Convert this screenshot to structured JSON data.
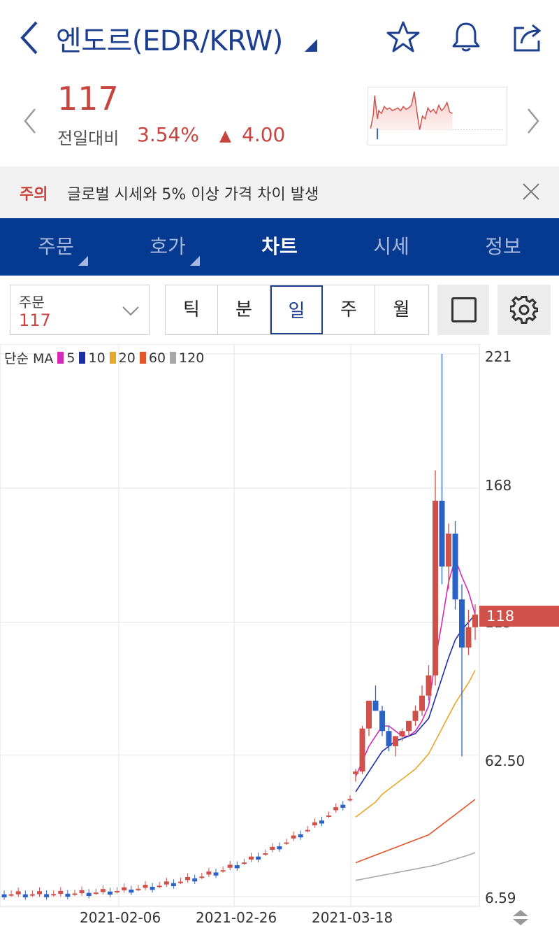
{
  "header": {
    "title": "엔도르(EDR/KRW)"
  },
  "price": {
    "current": "117",
    "prev_label": "전일대비",
    "change_pct": "3.54%",
    "change_symbol": "▲",
    "change_abs": "4.00"
  },
  "notice": {
    "tag": "주의",
    "text": "글로벌 시세와 5% 이상 가격 차이 발생"
  },
  "tabs": [
    {
      "label": "주문"
    },
    {
      "label": "호가"
    },
    {
      "label": "차트"
    },
    {
      "label": "시세"
    },
    {
      "label": "정보"
    }
  ],
  "controls": {
    "order_label": "주문",
    "order_value": "117",
    "periods": [
      "틱",
      "분",
      "일",
      "주",
      "월"
    ],
    "active_period": "일"
  },
  "colors": {
    "accent": "#063a91",
    "up": "#d0504a",
    "down": "#2b62c6",
    "ma5": "#d629b8",
    "ma10": "#1b2fa8",
    "ma20": "#e8a72a",
    "ma60": "#e2542a",
    "ma120": "#a8a8a8"
  },
  "chart": {
    "legend_prefix": "단순 MA",
    "ma_periods": [
      "5",
      "10",
      "20",
      "60",
      "120"
    ],
    "y_ticks": [
      "221",
      "168",
      "115",
      "62.50",
      "6.59"
    ],
    "current_price_label": "118",
    "x_ticks": [
      "2021-02-06",
      "2021-02-26",
      "2021-03-18"
    ]
  },
  "chart_data": {
    "type": "candlestick",
    "ylim": [
      6.59,
      221
    ],
    "yticks": [
      221,
      168,
      115,
      62.5,
      6.59
    ],
    "xticks": [
      "2021-02-06",
      "2021-02-26",
      "2021-03-18"
    ],
    "candles": [
      {
        "date": "2021-03-18",
        "open": 55,
        "high": 57,
        "low": 52,
        "close": 56
      },
      {
        "date": "2021-03-19",
        "open": 56,
        "high": 74,
        "low": 55,
        "close": 73
      },
      {
        "date": "2021-03-20",
        "open": 73,
        "high": 84,
        "low": 70,
        "close": 84
      },
      {
        "date": "2021-03-21",
        "open": 84,
        "high": 90,
        "low": 80,
        "close": 80
      },
      {
        "date": "2021-03-22",
        "open": 80,
        "high": 82,
        "low": 70,
        "close": 72
      },
      {
        "date": "2021-03-23",
        "open": 72,
        "high": 74,
        "low": 64,
        "close": 66
      },
      {
        "date": "2021-03-24",
        "open": 66,
        "high": 70,
        "low": 62,
        "close": 70
      },
      {
        "date": "2021-03-25",
        "open": 70,
        "high": 73,
        "low": 68,
        "close": 72
      },
      {
        "date": "2021-03-26",
        "open": 72,
        "high": 76,
        "low": 70,
        "close": 76
      },
      {
        "date": "2021-03-27",
        "open": 76,
        "high": 82,
        "low": 74,
        "close": 80
      },
      {
        "date": "2021-03-28",
        "open": 80,
        "high": 90,
        "low": 78,
        "close": 86
      },
      {
        "date": "2021-03-29",
        "open": 86,
        "high": 98,
        "low": 84,
        "close": 94
      },
      {
        "date": "2021-03-30",
        "open": 94,
        "high": 175,
        "low": 90,
        "close": 163
      },
      {
        "date": "2021-03-31",
        "open": 163,
        "high": 221,
        "low": 130,
        "close": 137
      },
      {
        "date": "2021-04-01",
        "open": 137,
        "high": 154,
        "low": 128,
        "close": 150
      },
      {
        "date": "2021-04-02",
        "open": 150,
        "high": 155,
        "low": 120,
        "close": 124
      },
      {
        "date": "2021-04-03",
        "open": 124,
        "high": 130,
        "low": 62,
        "close": 105
      },
      {
        "date": "2021-04-04",
        "open": 105,
        "high": 120,
        "low": 102,
        "close": 113
      },
      {
        "date": "2021-04-05",
        "open": 113,
        "high": 122,
        "low": 108,
        "close": 118
      }
    ],
    "series": [
      {
        "name": "5",
        "values": [
          54,
          60,
          66,
          70,
          74,
          74,
          72,
          70,
          70,
          72,
          76,
          82,
          100,
          115,
          131,
          140,
          133,
          127,
          118
        ]
      },
      {
        "name": "10",
        "values": [
          48,
          52,
          56,
          60,
          64,
          66,
          68,
          69,
          70,
          71,
          74,
          77,
          85,
          93,
          101,
          108,
          112,
          115,
          118
        ]
      },
      {
        "name": "20",
        "values": [
          38,
          40,
          42,
          44,
          47,
          49,
          51,
          53,
          55,
          57,
          60,
          63,
          68,
          73,
          78,
          83,
          87,
          91,
          96
        ]
      },
      {
        "name": "60",
        "values": [
          20,
          21,
          22,
          23,
          24,
          25,
          26,
          27,
          28,
          29,
          30,
          31,
          33,
          35,
          37,
          39,
          41,
          43,
          45
        ]
      },
      {
        "name": "120",
        "values": [
          13,
          13.5,
          14,
          14.5,
          15,
          15.5,
          16,
          16.5,
          17,
          17.5,
          18,
          18.5,
          19,
          19.8,
          20.6,
          21.4,
          22.2,
          23,
          24
        ]
      }
    ],
    "current_price": 118
  }
}
